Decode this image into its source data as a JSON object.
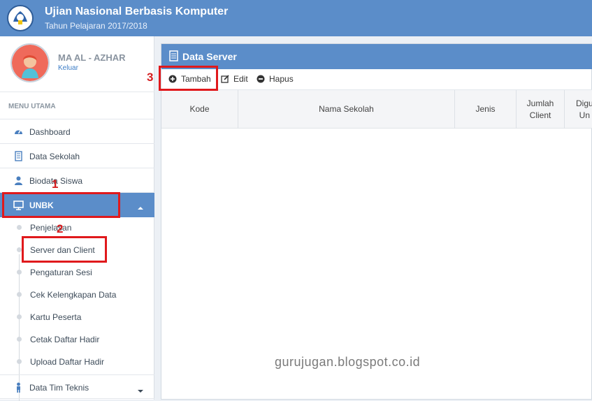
{
  "header": {
    "title": "Ujian Nasional Berbasis Komputer",
    "subtitle": "Tahun Pelajaran 2017/2018",
    "logo_icon": "tut-wuri-handayani-logo"
  },
  "user": {
    "name": "MA AL - AZHAR",
    "logout": "Keluar",
    "avatar_icon": "user-avatar-icon"
  },
  "menu": {
    "header": "MENU UTAMA",
    "items": [
      {
        "label": "Dashboard",
        "icon": "dashboard-icon"
      },
      {
        "label": "Data Sekolah",
        "icon": "building-icon"
      },
      {
        "label": "Biodata Siswa",
        "icon": "user-icon"
      },
      {
        "label": "UNBK",
        "icon": "monitor-icon"
      },
      {
        "label": "Data Tim Teknis",
        "icon": "person-icon"
      }
    ],
    "unbk_sub": [
      "Penjelasan",
      "Server dan Client",
      "Pengaturan Sesi",
      "Cek Kelengkapan Data",
      "Kartu Peserta",
      "Cetak Daftar Hadir",
      "Upload Daftar Hadir"
    ]
  },
  "panel": {
    "title": "Data Server",
    "toolbar": {
      "add": "Tambah",
      "edit": "Edit",
      "delete": "Hapus"
    },
    "columns": [
      "Kode",
      "Nama Sekolah",
      "Jenis",
      "Jumlah Client",
      "Digu Un"
    ]
  },
  "annotations": [
    "1",
    "2",
    "3"
  ],
  "watermark": "gurujugan.blogspot.co.id",
  "colors": {
    "primary": "#5b8dc9",
    "highlight": "#e0191c"
  }
}
